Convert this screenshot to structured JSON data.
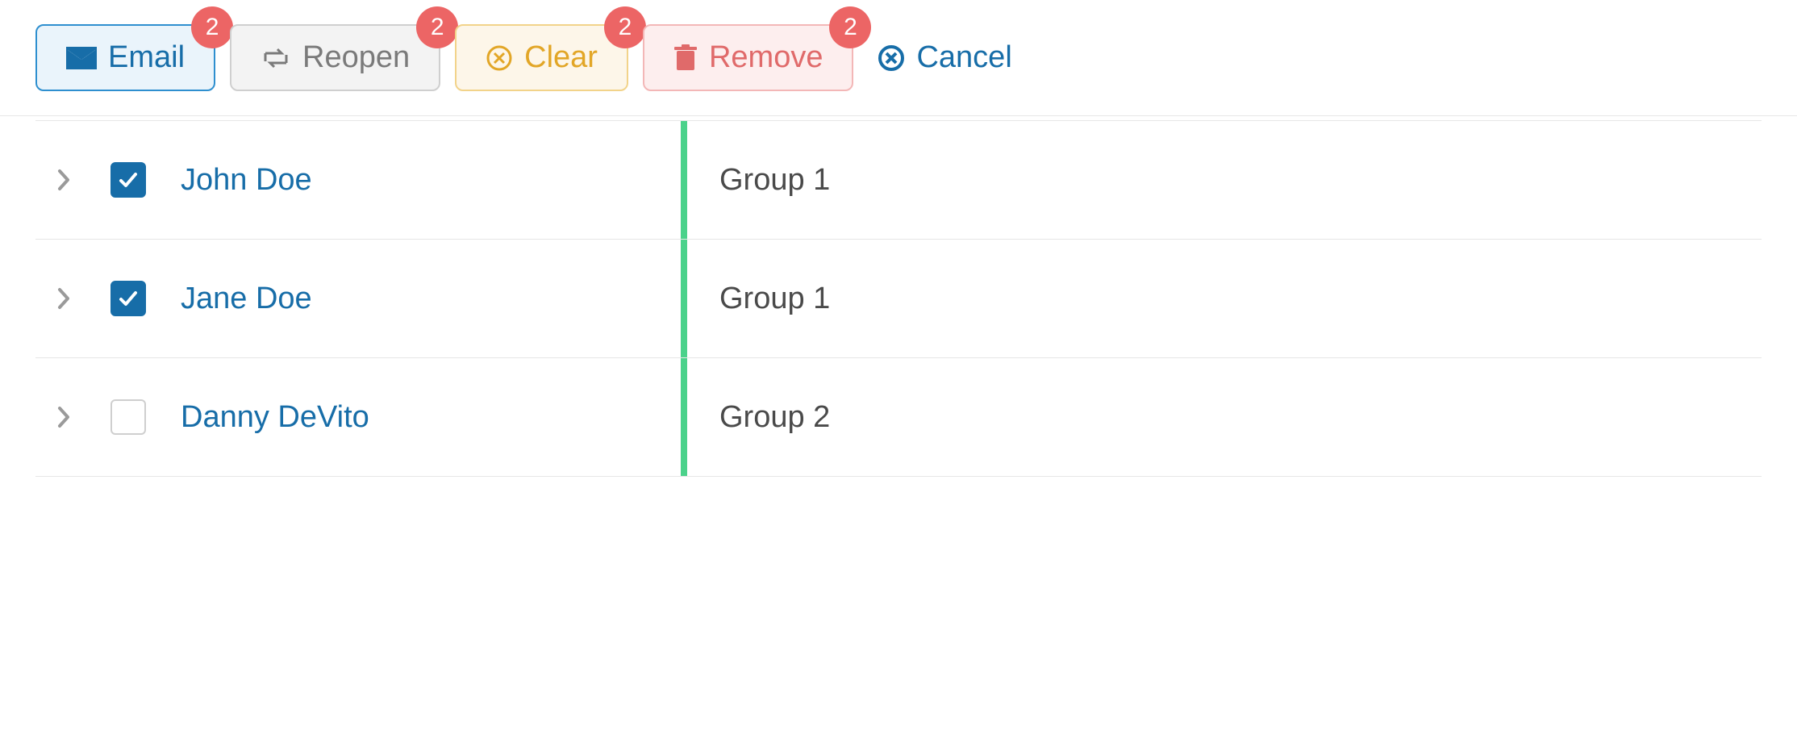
{
  "toolbar": {
    "email": {
      "label": "Email",
      "badge": "2"
    },
    "reopen": {
      "label": "Reopen",
      "badge": "2"
    },
    "clear": {
      "label": "Clear",
      "badge": "2"
    },
    "remove": {
      "label": "Remove",
      "badge": "2"
    },
    "cancel": {
      "label": "Cancel"
    }
  },
  "rows": [
    {
      "name": "John Doe",
      "group": "Group 1",
      "checked": true
    },
    {
      "name": "Jane Doe",
      "group": "Group 1",
      "checked": true
    },
    {
      "name": "Danny DeVito",
      "group": "Group 2",
      "checked": false
    }
  ]
}
